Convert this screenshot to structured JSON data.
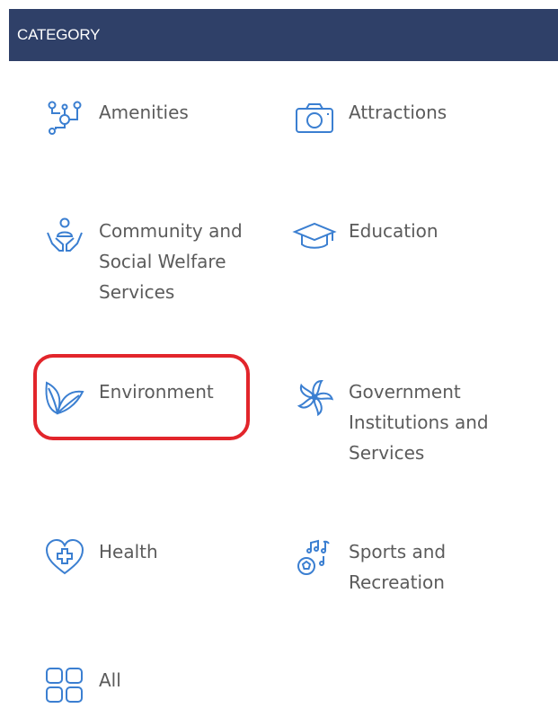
{
  "header": {
    "title": "CATEGORY"
  },
  "categories": [
    {
      "label": "Amenities",
      "icon": "amenities-network-icon"
    },
    {
      "label": "Attractions",
      "icon": "camera-icon"
    },
    {
      "label": "Community and Social Welfare Services",
      "icon": "community-hands-icon"
    },
    {
      "label": "Education",
      "icon": "graduation-cap-icon"
    },
    {
      "label": "Environment",
      "icon": "leaves-icon",
      "highlighted": true
    },
    {
      "label": "Government Institutions and Services",
      "icon": "bauhinia-flower-icon"
    },
    {
      "label": "Health",
      "icon": "heart-plus-icon"
    },
    {
      "label": "Sports and Recreation",
      "icon": "ball-music-icon"
    },
    {
      "label": "All",
      "icon": "grid-icon"
    }
  ],
  "colors": {
    "header_bg": "#2f4068",
    "icon": "#3b7fd1",
    "highlight": "#e2252b",
    "text": "#5b5b5b"
  }
}
